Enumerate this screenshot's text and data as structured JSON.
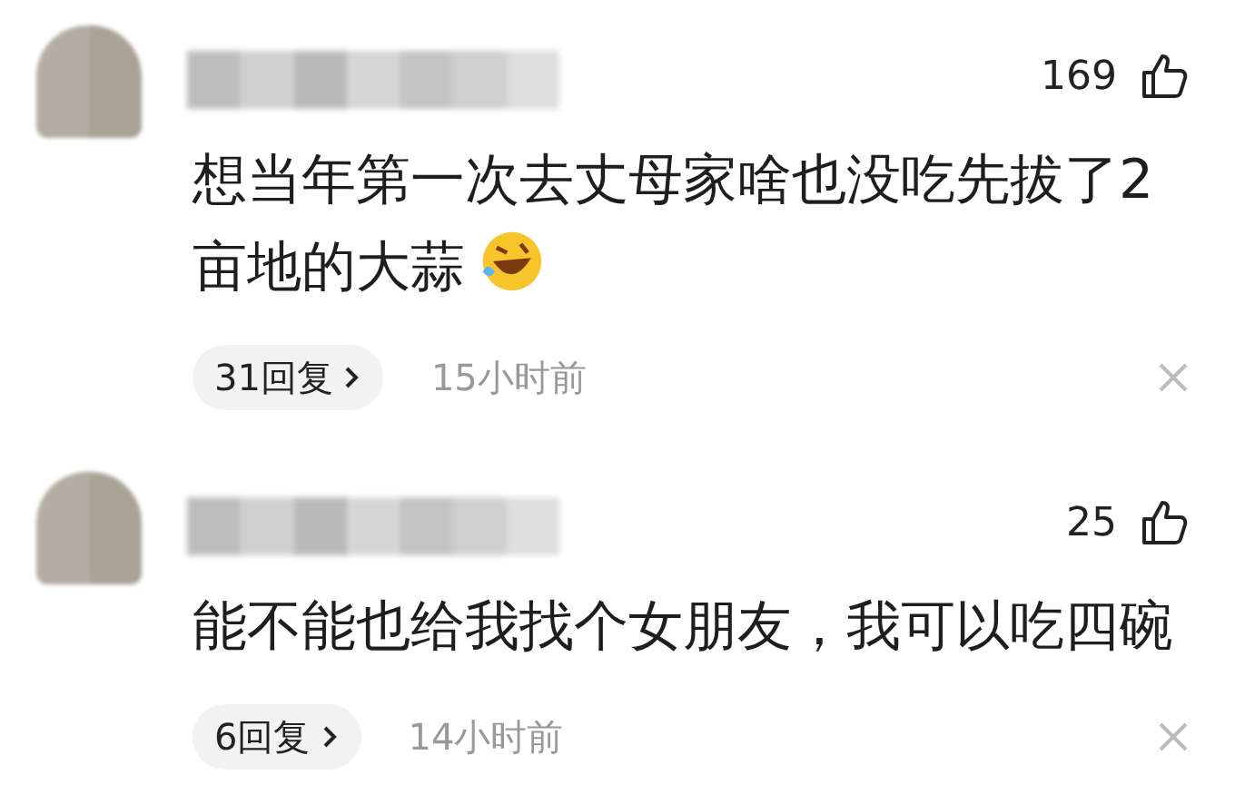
{
  "comments": [
    {
      "likes": "169",
      "text": "想当年第一次去丈母家啥也没吃先拔了2亩地的大蒜",
      "has_emoji": true,
      "replies": "31回复",
      "time": "15小时前"
    },
    {
      "likes": "25",
      "text": "能不能也给我找个女朋友，我可以吃四碗",
      "has_emoji": false,
      "replies": "6回复",
      "time": "14小时前"
    }
  ]
}
